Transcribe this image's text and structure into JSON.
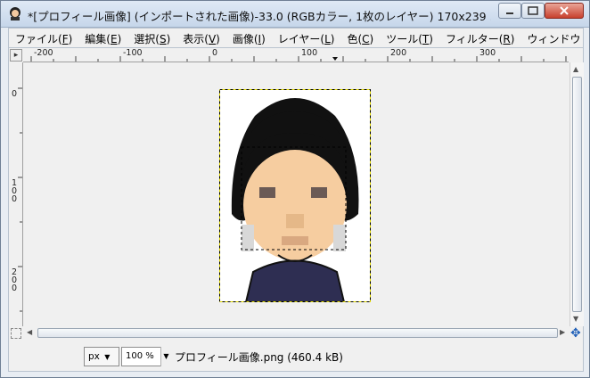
{
  "window": {
    "title": "*[プロフィール画像] (インポートされた画像)-33.0 (RGBカラー, 1枚のレイヤー) 170x239 ..."
  },
  "menubar": {
    "items": [
      {
        "label": "ファイル(",
        "key": "F",
        "end": ")"
      },
      {
        "label": "編集(",
        "key": "E",
        "end": ")"
      },
      {
        "label": "選択(",
        "key": "S",
        "end": ")"
      },
      {
        "label": "表示(",
        "key": "V",
        "end": ")"
      },
      {
        "label": "画像(",
        "key": "I",
        "end": ")"
      },
      {
        "label": "レイヤー(",
        "key": "L",
        "end": ")"
      },
      {
        "label": "色(",
        "key": "C",
        "end": ")"
      },
      {
        "label": "ツール(",
        "key": "T",
        "end": ")"
      },
      {
        "label": "フィルター(",
        "key": "R",
        "end": ")"
      },
      {
        "label": "ウィンドウ",
        "key": "",
        "end": ""
      }
    ]
  },
  "ruler": {
    "h_labels": [
      "-200",
      "-100",
      "0",
      "100",
      "200",
      "300"
    ],
    "v_labels": [
      "0",
      "100",
      "200"
    ]
  },
  "statusbar": {
    "unit": "px",
    "zoom": "100 %",
    "file_info": "プロフィール画像.png (460.4 kB)"
  },
  "icons": {
    "app": "gimp-icon",
    "navigate": "navigate-icon",
    "quick_mask": "quick-mask-icon"
  },
  "colors": {
    "hair": "#111111",
    "skin": "#f6cda0",
    "shirt": "#2e2e52",
    "selection": "#000000"
  }
}
